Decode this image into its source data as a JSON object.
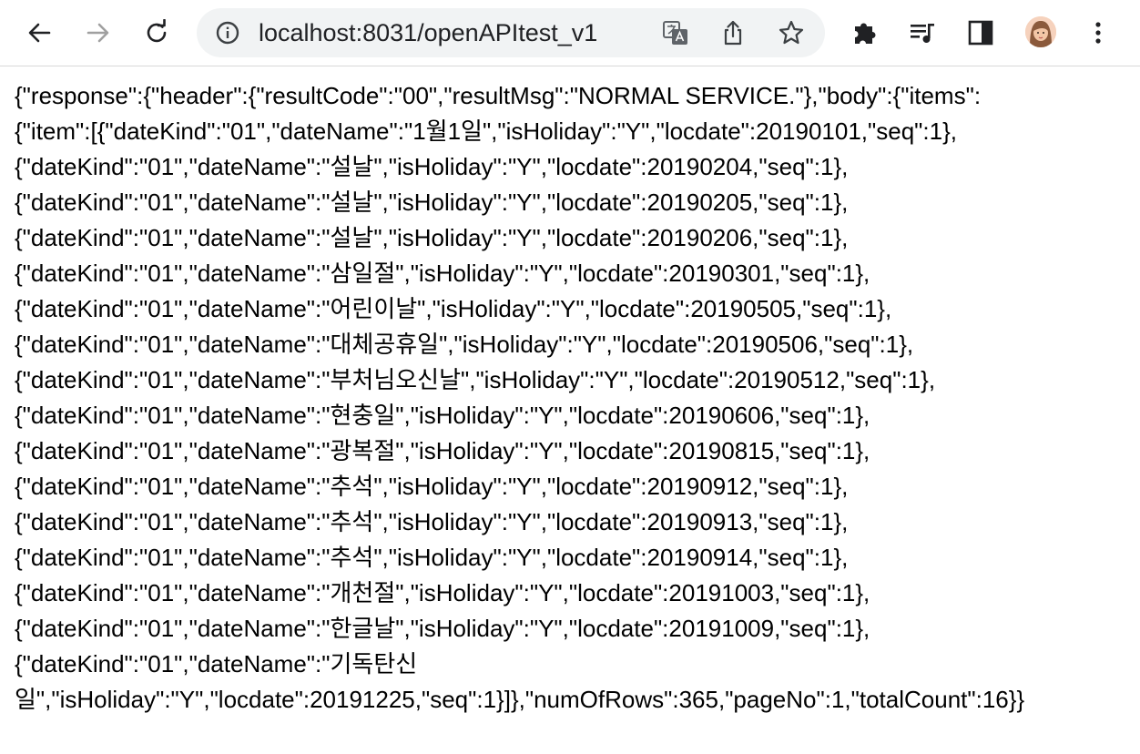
{
  "browser": {
    "url": "localhost:8031/openAPItest_v1",
    "icons": {
      "back": "arrow-left-icon",
      "forward": "arrow-right-icon",
      "reload": "reload-icon",
      "info": "info-icon",
      "translate": "translate-icon",
      "share": "share-icon",
      "bookmark": "star-icon",
      "extensions": "puzzle-icon",
      "media": "media-queue-icon",
      "side_panel": "side-panel-icon",
      "profile": "avatar",
      "menu": "kebab-menu-icon"
    }
  },
  "content": {
    "lines": [
      "{\"response\":{\"header\":{\"resultCode\":\"00\",\"resultMsg\":\"NORMAL SERVICE.\"},\"body\":{\"items\":",
      "{\"item\":[{\"dateKind\":\"01\",\"dateName\":\"1월1일\",\"isHoliday\":\"Y\",\"locdate\":20190101,\"seq\":1},",
      "{\"dateKind\":\"01\",\"dateName\":\"설날\",\"isHoliday\":\"Y\",\"locdate\":20190204,\"seq\":1},",
      "{\"dateKind\":\"01\",\"dateName\":\"설날\",\"isHoliday\":\"Y\",\"locdate\":20190205,\"seq\":1},",
      "{\"dateKind\":\"01\",\"dateName\":\"설날\",\"isHoliday\":\"Y\",\"locdate\":20190206,\"seq\":1},",
      "{\"dateKind\":\"01\",\"dateName\":\"삼일절\",\"isHoliday\":\"Y\",\"locdate\":20190301,\"seq\":1},",
      "{\"dateKind\":\"01\",\"dateName\":\"어린이날\",\"isHoliday\":\"Y\",\"locdate\":20190505,\"seq\":1},",
      "{\"dateKind\":\"01\",\"dateName\":\"대체공휴일\",\"isHoliday\":\"Y\",\"locdate\":20190506,\"seq\":1},",
      "{\"dateKind\":\"01\",\"dateName\":\"부처님오신날\",\"isHoliday\":\"Y\",\"locdate\":20190512,\"seq\":1},",
      "{\"dateKind\":\"01\",\"dateName\":\"현충일\",\"isHoliday\":\"Y\",\"locdate\":20190606,\"seq\":1},",
      "{\"dateKind\":\"01\",\"dateName\":\"광복절\",\"isHoliday\":\"Y\",\"locdate\":20190815,\"seq\":1},",
      "{\"dateKind\":\"01\",\"dateName\":\"추석\",\"isHoliday\":\"Y\",\"locdate\":20190912,\"seq\":1},",
      "{\"dateKind\":\"01\",\"dateName\":\"추석\",\"isHoliday\":\"Y\",\"locdate\":20190913,\"seq\":1},",
      "{\"dateKind\":\"01\",\"dateName\":\"추석\",\"isHoliday\":\"Y\",\"locdate\":20190914,\"seq\":1},",
      "{\"dateKind\":\"01\",\"dateName\":\"개천절\",\"isHoliday\":\"Y\",\"locdate\":20191003,\"seq\":1},",
      "{\"dateKind\":\"01\",\"dateName\":\"한글날\",\"isHoliday\":\"Y\",\"locdate\":20191009,\"seq\":1},",
      "{\"dateKind\":\"01\",\"dateName\":\"기독탄신",
      "일\",\"isHoliday\":\"Y\",\"locdate\":20191225,\"seq\":1}]},\"numOfRows\":365,\"pageNo\":1,\"totalCount\":16}}"
    ]
  }
}
